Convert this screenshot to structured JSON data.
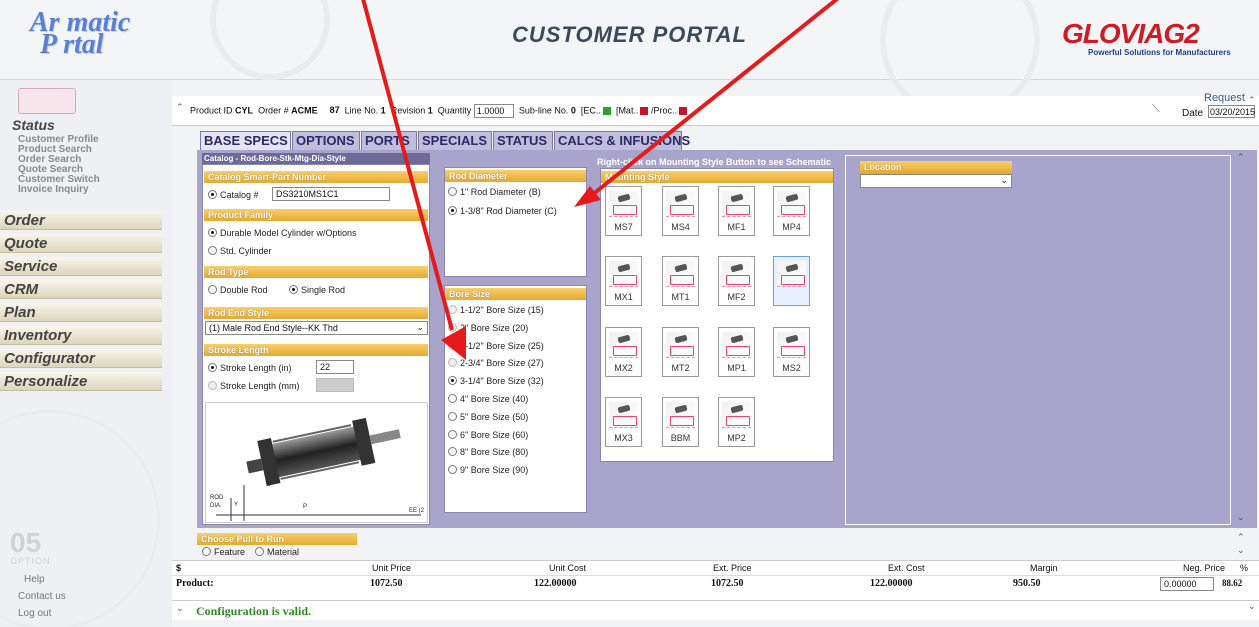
{
  "header": {
    "logo_line1": "Ar matic",
    "logo_line2": "P rtal",
    "title": "CUSTOMER PORTAL",
    "brand_main": "GLOVIA",
    "brand_suffix": "G2",
    "brand_tagline": "Powerful Solutions for Manufacturers"
  },
  "sidebar": {
    "status_heading": "Status",
    "status_links": [
      "Customer Profile",
      "Product Search",
      "Order Search",
      "Quote Search",
      "Customer Switch",
      "Invoice Inquiry"
    ],
    "menu": [
      "Order",
      "Quote",
      "Service",
      "CRM",
      "Plan",
      "Inventory",
      "Configurator",
      "Personalize"
    ],
    "footer_brand": "05",
    "footer_brand_sub": "OPTION",
    "footer_links": [
      "Help",
      "Contact us",
      "Log out"
    ]
  },
  "product_bar": {
    "product_id_label": "Product ID",
    "product_id": "CYL",
    "order_label": "Order #",
    "order": "ACME",
    "order_tail": "87",
    "line_label": "Line No.",
    "line": "1",
    "revision_label": "Revision",
    "revision": "1",
    "quantity_label": "Quantity",
    "quantity": "1.0000",
    "subline_label": "Sub-line No.",
    "subline": "0",
    "ec_label": "[EC..",
    "mat_label": "[Mat..",
    "proc_label": "/Proc..",
    "request_label": "Request",
    "date_label": "Date",
    "date": "03/20/2015"
  },
  "tabs": [
    "BASE SPECS",
    "OPTIONS",
    "PORTS",
    "SPECIALS",
    "STATUS",
    "CALCS & INFUSIONS"
  ],
  "catalog_group": "Catalog - Rod-Bore-Stk-Mtg-Dia-Style",
  "smart_part": {
    "header": "Catalog Smart-Part Number",
    "label": "Catalog #",
    "value": "DS3210MS1C1"
  },
  "product_family": {
    "header": "Product Family",
    "options": [
      "Durable Model Cylinder w/Options",
      "Std. Cylinder"
    ],
    "selected": 0
  },
  "rod_type": {
    "header": "Rod Type",
    "options": [
      "Double Rod",
      "Single Rod"
    ],
    "selected": 1
  },
  "rod_end_style": {
    "header": "Rod End Style",
    "value": "(1) Male Rod End Style--KK Thd"
  },
  "stroke_length": {
    "header": "Stroke Length",
    "in_label": "Stroke Length (in)",
    "in_value": "22",
    "mm_label": "Stroke Length (mm)"
  },
  "diagram_labels": {
    "rod_label": "ROD",
    "dia_label": "DIA.",
    "y_label": "Y",
    "k_label": "K",
    "p_label": "P",
    "ee_label": "EE (2"
  },
  "rod_diameter": {
    "header": "Rod Diameter",
    "options": [
      "1\" Rod Diameter (B)",
      "1-3/8\" Rod Diameter (C)"
    ],
    "selected": 1
  },
  "bore_size": {
    "header": "Bore Size",
    "options": [
      "1-1/2\" Bore Size (15)",
      "2\" Bore Size (20)",
      "2-1/2\" Bore Size (25)",
      "2-3/4\" Bore Size (27)",
      "3-1/4\" Bore Size (32)",
      "4\" Bore Size (40)",
      "5\" Bore Size (50)",
      "6\" Bore Size (60)",
      "8\" Bore Size (80)",
      "9\" Bore Size (90)"
    ],
    "selected": 4
  },
  "mounting": {
    "hint": "Right-click on Mounting Style Button to see Schematic",
    "header": "Mounting Style",
    "styles": [
      "MS7",
      "MS4",
      "MF1",
      "MP4",
      "MX1",
      "MT1",
      "MF2",
      "",
      "MX2",
      "MT2",
      "MP1",
      "MS2",
      "MX3",
      "BBM",
      "MP2"
    ]
  },
  "location": {
    "header": "Location",
    "value": ""
  },
  "pull": {
    "header": "Choose Pull to Run",
    "options": [
      "Feature",
      "Material"
    ]
  },
  "pricing": {
    "currency": "$",
    "headers": [
      "Unit Price",
      "Unit Cost",
      "Ext. Price",
      "Ext. Cost",
      "Margin",
      "Neg. Price",
      "%"
    ],
    "row_label": "Product:",
    "values": [
      "1072.50",
      "122.00000",
      "1072.50",
      "122.00000",
      "950.50",
      "0.00000",
      "88.62"
    ]
  },
  "validation": "Configuration is valid.",
  "colors": {
    "accent_red": "#e02020",
    "panel_header": "#f0b440",
    "panel_bg": "#a9a4cc",
    "valid_green": "#2d8a25"
  }
}
